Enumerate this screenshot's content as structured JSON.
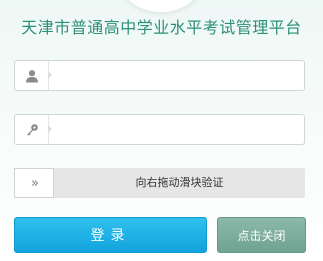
{
  "header": {
    "title": "天津市普通高中学业水平考试管理平台"
  },
  "login": {
    "username_icon": "user-icon",
    "username_value": "",
    "password_icon": "key-icon",
    "password_value": "",
    "slider_handle_glyph": "»",
    "slider_text": "向右拖动滑块验证",
    "login_label": "登录",
    "close_label": "点击关闭"
  },
  "colors": {
    "title": "#2c8f78",
    "login_button": "#1aa9e0",
    "close_button": "#79a99a"
  }
}
